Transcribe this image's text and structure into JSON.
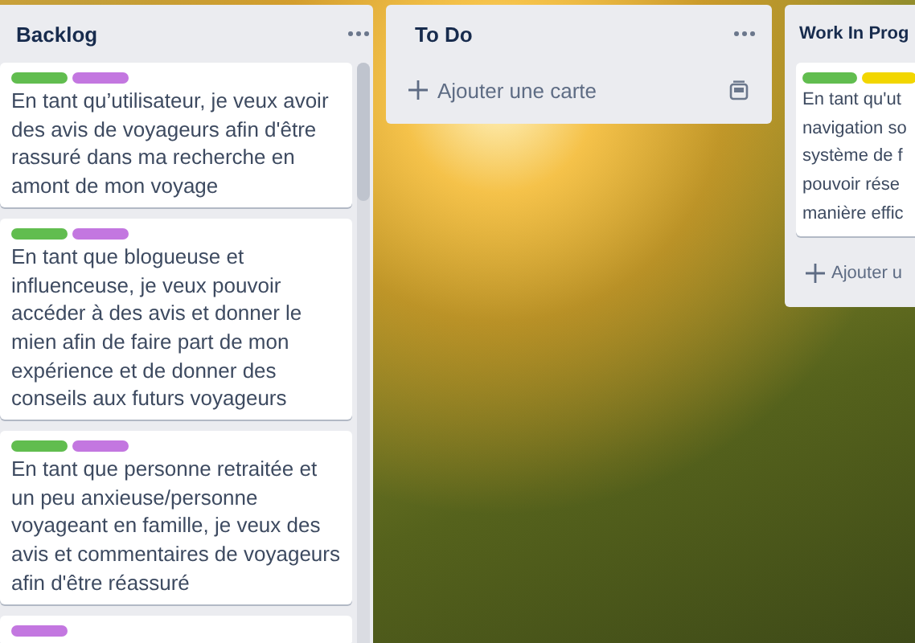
{
  "lists": [
    {
      "title": "Backlog",
      "menu": true,
      "scrollbar": true,
      "cards": [
        {
          "labels": [
            {
              "color": "#61bd4f"
            },
            {
              "color": "#c377e0"
            }
          ],
          "text": "En tant qu’utilisateur, je veux avoir des avis de voyageurs afin d'être rassuré dans ma recherche en amont de mon voyage"
        },
        {
          "labels": [
            {
              "color": "#61bd4f"
            },
            {
              "color": "#c377e0"
            }
          ],
          "text": "En tant que blogueuse et influenceuse, je veux pouvoir accéder à des avis et donner le mien afin de faire part de mon expérience et de donner des conseils aux futurs voyageurs"
        },
        {
          "labels": [
            {
              "color": "#61bd4f"
            },
            {
              "color": "#c377e0"
            }
          ],
          "text": "En tant que personne retraitée et un peu anxieuse/personne voyageant en famille, je veux des avis et commentaires de voyageurs afin d'être réassuré"
        },
        {
          "labels": [
            {
              "color": "#c377e0"
            }
          ]
        }
      ]
    },
    {
      "title": "To Do",
      "menu": true,
      "scrollbar": false,
      "add_card": "Ajouter une carte",
      "template_button": true
    },
    {
      "title": "Work In Prog",
      "menu": false,
      "scrollbar": false,
      "cards": [
        {
          "labels": [
            {
              "color": "#61bd4f"
            },
            {
              "color": "#f2d600"
            }
          ],
          "lines": [
            "En tant qu'ut",
            "navigation so",
            "système de f",
            "pouvoir rése",
            "manière effic"
          ]
        }
      ],
      "add_card": "Ajouter u",
      "template_button": false
    }
  ]
}
